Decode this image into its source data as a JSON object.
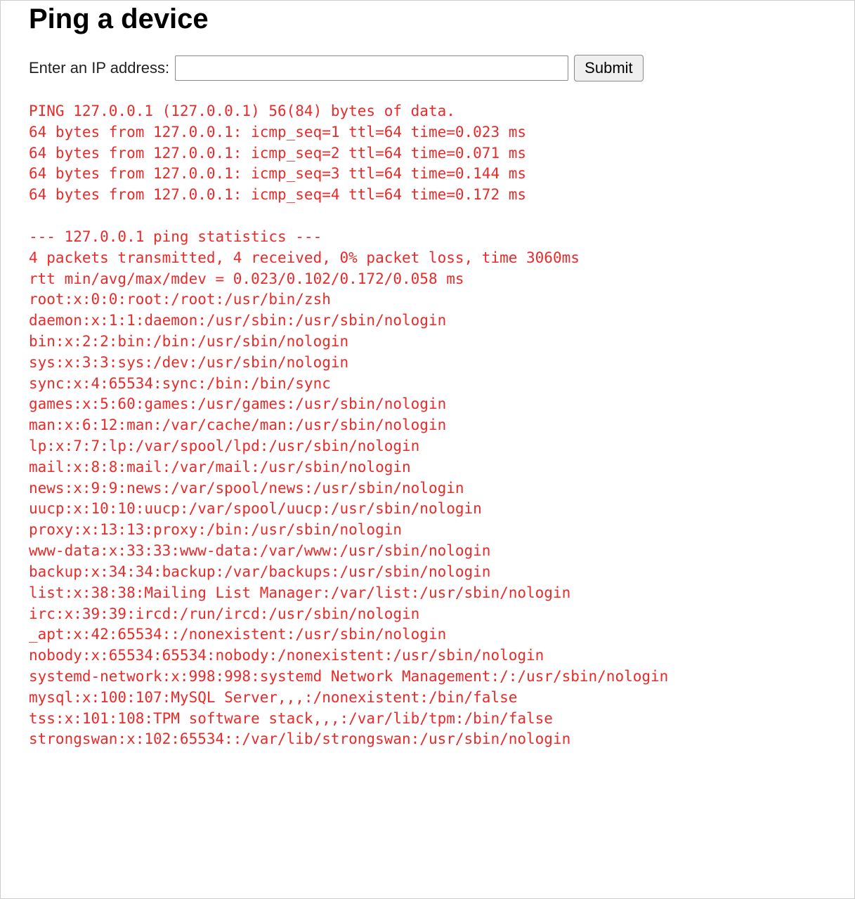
{
  "header": {
    "title": "Ping a device"
  },
  "form": {
    "label": "Enter an IP address:",
    "ip_value": "",
    "submit_label": "Submit"
  },
  "output_lines": [
    "PING 127.0.0.1 (127.0.0.1) 56(84) bytes of data.",
    "64 bytes from 127.0.0.1: icmp_seq=1 ttl=64 time=0.023 ms",
    "64 bytes from 127.0.0.1: icmp_seq=2 ttl=64 time=0.071 ms",
    "64 bytes from 127.0.0.1: icmp_seq=3 ttl=64 time=0.144 ms",
    "64 bytes from 127.0.0.1: icmp_seq=4 ttl=64 time=0.172 ms",
    "",
    "--- 127.0.0.1 ping statistics ---",
    "4 packets transmitted, 4 received, 0% packet loss, time 3060ms",
    "rtt min/avg/max/mdev = 0.023/0.102/0.172/0.058 ms",
    "root:x:0:0:root:/root:/usr/bin/zsh",
    "daemon:x:1:1:daemon:/usr/sbin:/usr/sbin/nologin",
    "bin:x:2:2:bin:/bin:/usr/sbin/nologin",
    "sys:x:3:3:sys:/dev:/usr/sbin/nologin",
    "sync:x:4:65534:sync:/bin:/bin/sync",
    "games:x:5:60:games:/usr/games:/usr/sbin/nologin",
    "man:x:6:12:man:/var/cache/man:/usr/sbin/nologin",
    "lp:x:7:7:lp:/var/spool/lpd:/usr/sbin/nologin",
    "mail:x:8:8:mail:/var/mail:/usr/sbin/nologin",
    "news:x:9:9:news:/var/spool/news:/usr/sbin/nologin",
    "uucp:x:10:10:uucp:/var/spool/uucp:/usr/sbin/nologin",
    "proxy:x:13:13:proxy:/bin:/usr/sbin/nologin",
    "www-data:x:33:33:www-data:/var/www:/usr/sbin/nologin",
    "backup:x:34:34:backup:/var/backups:/usr/sbin/nologin",
    "list:x:38:38:Mailing List Manager:/var/list:/usr/sbin/nologin",
    "irc:x:39:39:ircd:/run/ircd:/usr/sbin/nologin",
    "_apt:x:42:65534::/nonexistent:/usr/sbin/nologin",
    "nobody:x:65534:65534:nobody:/nonexistent:/usr/sbin/nologin",
    "systemd-network:x:998:998:systemd Network Management:/:/usr/sbin/nologin",
    "mysql:x:100:107:MySQL Server,,,:/nonexistent:/bin/false",
    "tss:x:101:108:TPM software stack,,,:/var/lib/tpm:/bin/false",
    "strongswan:x:102:65534::/var/lib/strongswan:/usr/sbin/nologin"
  ]
}
